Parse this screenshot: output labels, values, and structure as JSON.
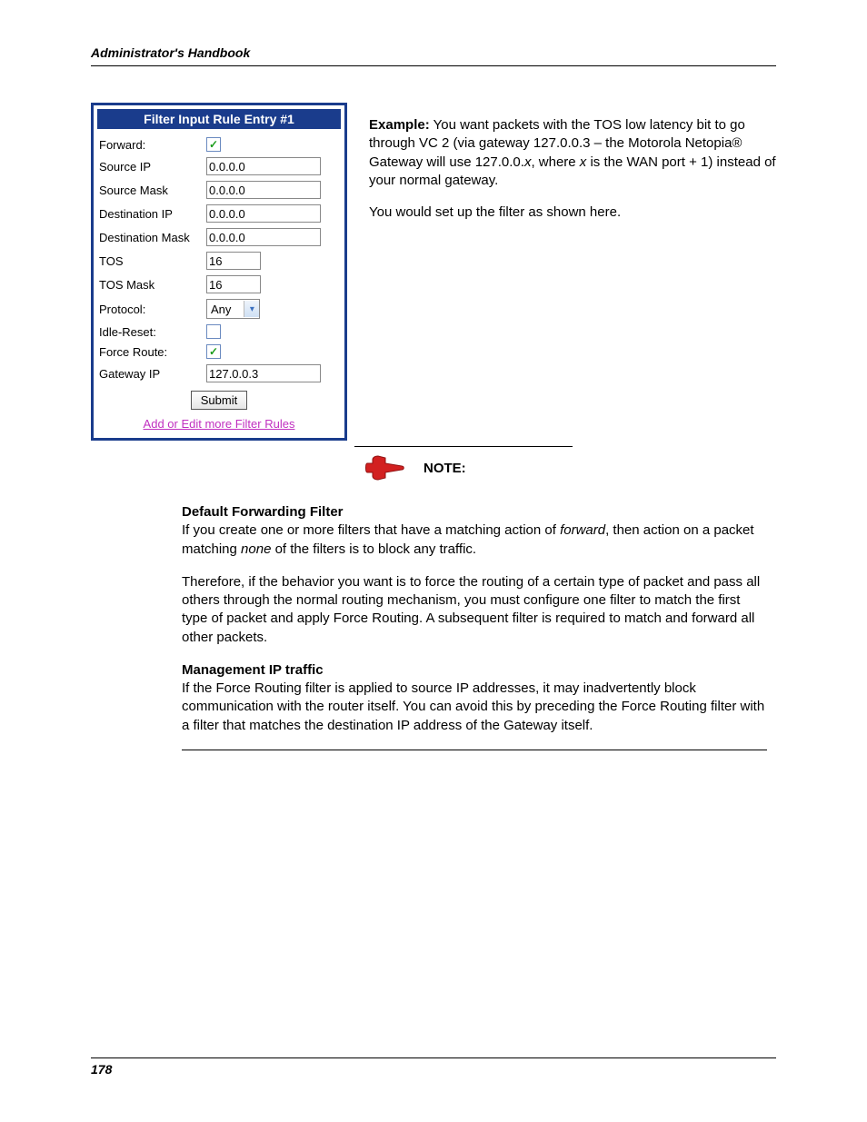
{
  "header": {
    "title": "Administrator's Handbook"
  },
  "panel": {
    "title": "Filter Input Rule Entry #1",
    "rows": {
      "forward_label": "Forward:",
      "forward_checked": "✓",
      "source_ip_label": "Source IP",
      "source_ip_value": "0.0.0.0",
      "source_mask_label": "Source Mask",
      "source_mask_value": "0.0.0.0",
      "dest_ip_label": "Destination IP",
      "dest_ip_value": "0.0.0.0",
      "dest_mask_label": "Destination Mask",
      "dest_mask_value": "0.0.0.0",
      "tos_label": "TOS",
      "tos_value": "16",
      "tos_mask_label": "TOS Mask",
      "tos_mask_value": "16",
      "protocol_label": "Protocol:",
      "protocol_value": "Any",
      "idle_reset_label": "Idle-Reset:",
      "idle_reset_checked": "",
      "force_route_label": "Force Route:",
      "force_route_checked": "✓",
      "gateway_ip_label": "Gateway IP",
      "gateway_ip_value": "127.0.0.3"
    },
    "submit_label": "Submit",
    "link_label": "Add or Edit more Filter Rules"
  },
  "example": {
    "lead": "Example:",
    "body1": " You want packets with the TOS low latency bit to go through VC 2 (via gateway 127.0.0.3 – the Motorola Netopia® Gateway will use 127.0.0.",
    "x": "x",
    "body1b": ", where ",
    "x2": "x",
    "body1c": " is the WAN port + 1) instead of your normal gateway.",
    "body2": "You would set up the filter as shown here."
  },
  "note": {
    "label": "NOTE:"
  },
  "sections": {
    "dff_head": "Default Forwarding Filter",
    "dff_p1a": "If you create one or more filters that have a matching action of ",
    "dff_p1_em1": "forward",
    "dff_p1b": ", then action on a packet matching ",
    "dff_p1_em2": "none",
    "dff_p1c": " of the filters is to block any traffic.",
    "dff_p2": "Therefore, if the behavior you want is to force the routing of a certain type of packet and pass all others through the normal routing mechanism, you must configure one filter to match the first type of packet and apply Force Routing. A subsequent filter is required to match and forward all other packets.",
    "mip_head": "Management IP traffic",
    "mip_p1": "If the Force Routing filter is applied to source IP addresses, it may inadvertently block communication with the router itself. You can avoid this by preceding the Force Routing filter with a filter that matches the destination IP address of the Gateway itself."
  },
  "footer": {
    "page": "178"
  }
}
